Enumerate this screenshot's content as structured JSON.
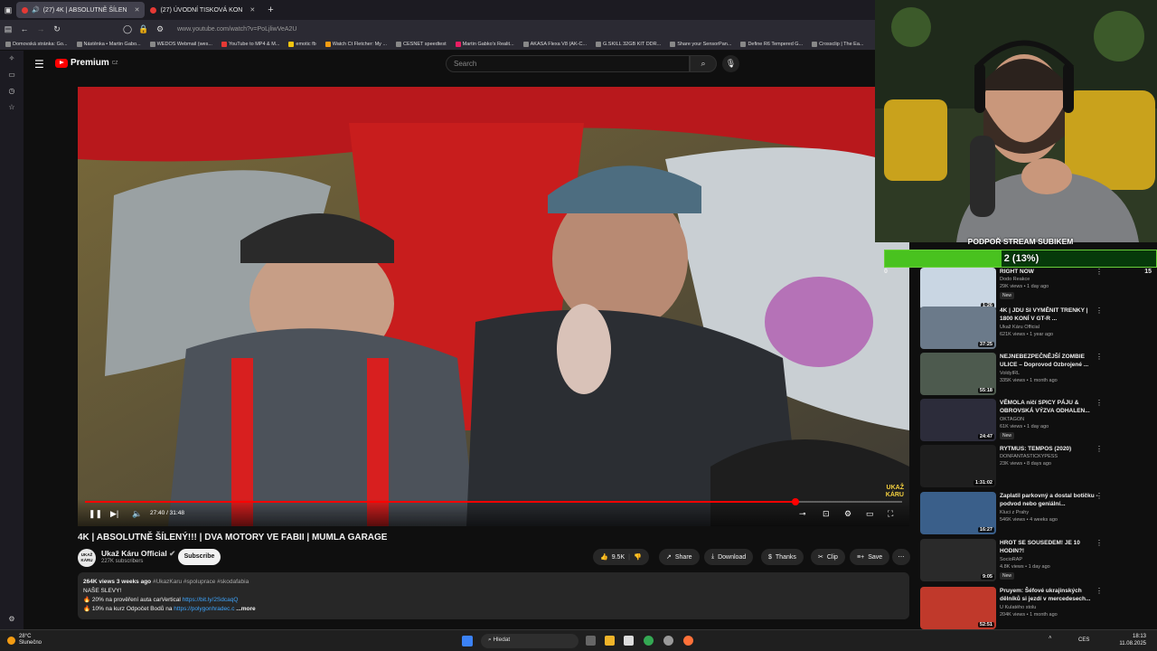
{
  "browser": {
    "tabs": [
      {
        "label": "(27) 4K | ABSOLUTNĚ ŠÍLEN",
        "active": true
      },
      {
        "label": "(27) ÚVODNÍ TISKOVÁ KON",
        "active": false
      }
    ],
    "new_tab": "+",
    "url": "www.youtube.com/watch?v=PoLjliwVeA2U",
    "bookmarks": [
      "Domovská stránka: Go...",
      "Nástěnka • Martin Gabo...",
      "WEDOS Webmail (wes...",
      "YouTube to MP4 & M...",
      "emotic fb",
      "Watch Ct Fletcher: My ...",
      "CESNET speedtest",
      "Martin Gabko's Realit...",
      "AKASA Flexa V8 (AK-C...",
      "G.SKILL 32GB KIT DDR...",
      "Share your SensorPan...",
      "Define R6 Tempered G...",
      "Crossclip | The Ea..."
    ]
  },
  "youtube": {
    "logo": "Premium",
    "region": "CZ",
    "search_placeholder": "Search"
  },
  "player": {
    "time": "27:40 / 31:48",
    "progress_fraction": 0.87,
    "watermark_line1": "UKAŽ",
    "watermark_line2": "KÁRU"
  },
  "video": {
    "title": "4K | ABSOLUTNĚ ŠÍLENÝ!!! | DVA MOTORY VE FABII | MUMLA GARAGE",
    "channel": "Ukaž Káru Official",
    "channel_logo_l1": "UKAŽ",
    "channel_logo_l2": "KÁRU",
    "subscribers": "227K subscribers",
    "subscribe_label": "Subscribe",
    "likes": "9.5K",
    "share": "Share",
    "download": "Download",
    "thanks": "Thanks",
    "clip": "Clip",
    "save": "Save",
    "desc_meta": "264K views  3 weeks ago",
    "desc_tags": "#UkazKaru #spoluprace #skodafabia",
    "desc_line2": "NAŠE SLEVY!",
    "desc_line3_text": "20% na prověření auta carVertical ",
    "desc_line3_link": "https://bit.ly/2SdcaqQ",
    "desc_line4_text": "10% na kurz Odpočet Bodů na ",
    "desc_line4_link": "https://polygonhradec.c",
    "desc_more": "...more"
  },
  "donation": {
    "title": "PODPOŘ STREAM SUBIKEM",
    "text": "2 (13%)",
    "fraction": 0.13,
    "min": "0",
    "max": "15"
  },
  "recommendations": [
    {
      "title": "RIGHT NOW",
      "channel": "Dodo Reakce",
      "views": "29K views • 1 day ago",
      "badge": "New",
      "duration": "1:26",
      "color": "#c9d6e3"
    },
    {
      "title": "4K | JDU SI VYMĚNIT TRENKY | 1800 KONÍ V GT-R ...",
      "channel": "Ukaž Káru Official",
      "views": "621K views • 1 year ago",
      "badge": "",
      "duration": "37:25",
      "color": "#6b7a8a"
    },
    {
      "title": "NEJNEBEZPEČNĚJŠÍ ZOMBIE ULICE – Doprovod Ozbrojené ...",
      "channel": "VoldyIRL",
      "views": "335K views • 1 month ago",
      "badge": "",
      "duration": "55:18",
      "color": "#4d5a4e"
    },
    {
      "title": "VĚMOLA ničí SPICY PÁJU & OBROVSKÁ VÝZVA ODHALEN...",
      "channel": "OKTAGON",
      "views": "61K views • 1 day ago",
      "badge": "New",
      "duration": "24:47",
      "color": "#2c2c3a"
    },
    {
      "title": "RYTMUS: TEMPOS (2020)",
      "channel": "DONFANTASTICKYPESS",
      "views": "23K views • 8 days ago",
      "badge": "",
      "duration": "1:31:02",
      "color": "#1e1e1e"
    },
    {
      "title": "Zaplatil parkovný a dostal botičku - podvod nebo geniální...",
      "channel": "Kluci z Prahy",
      "views": "546K views • 4 weeks ago",
      "badge": "",
      "duration": "16:27",
      "color": "#3a5f8a"
    },
    {
      "title": "HROT SE SOUSEDEM! JE 10 HODIN?!",
      "channel": "SocioRAP",
      "views": "4.8K views • 1 day ago",
      "badge": "New",
      "duration": "9:05",
      "color": "#2a2a2a"
    },
    {
      "title": "Pruyem: Šéfové ukrajinských dělníků si jezdí v mercedesech...",
      "channel": "U Kulatého stolu",
      "views": "204K views • 1 month ago",
      "badge": "",
      "duration": "52:51",
      "color": "#c0392b"
    }
  ],
  "taskbar": {
    "temperature": "28°C",
    "weather": "Slunečno",
    "search": "Hledat",
    "lang": "CES",
    "time": "18:13",
    "date": "11.08.2025"
  }
}
